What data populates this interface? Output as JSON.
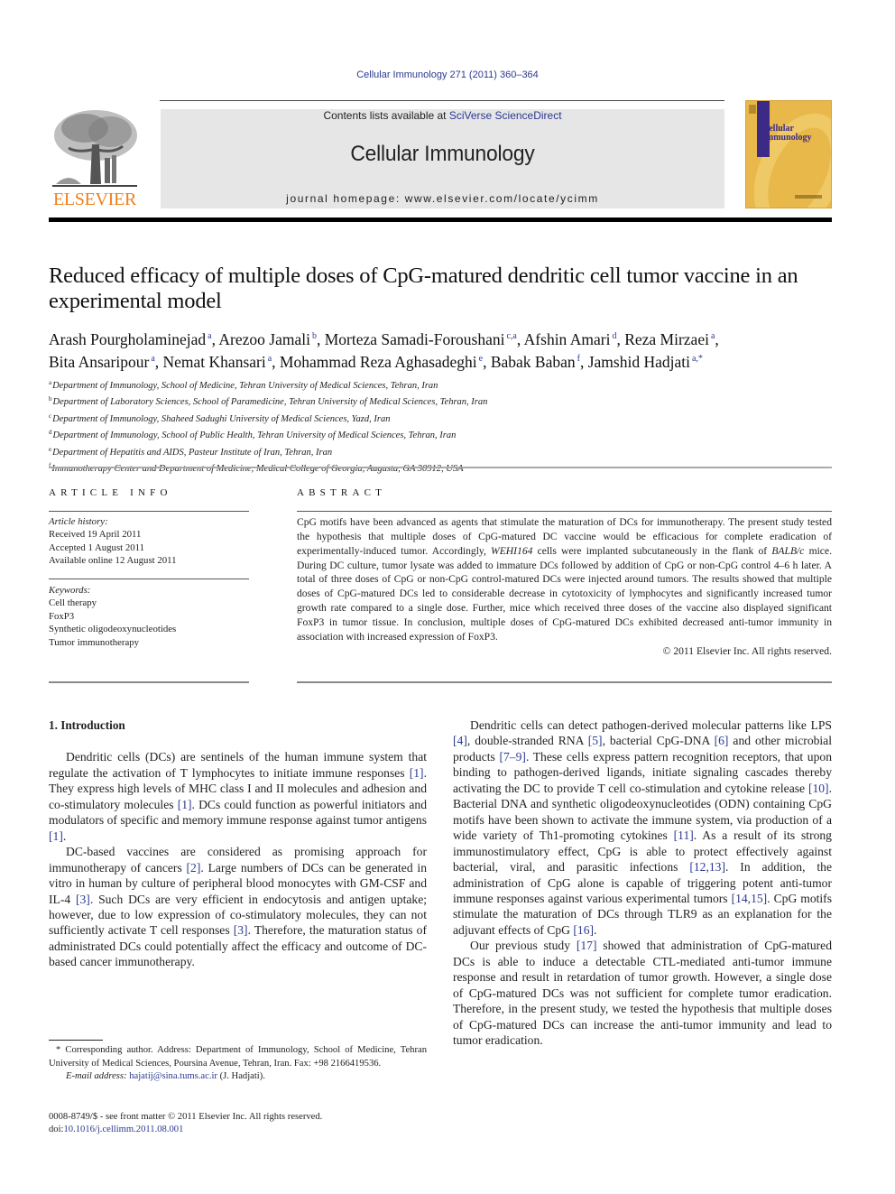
{
  "header": {
    "citation": "Cellular Immunology 271 (2011) 360–364",
    "contents_prefix": "Contents lists available at ",
    "contents_link": "SciVerse ScienceDirect",
    "journal_name": "Cellular Immunology",
    "homepage_prefix": "journal homepage: ",
    "homepage_url": "www.elsevier.com/locate/ycimm",
    "publisher_logo_text": "ELSEVIER",
    "cover_title_line1": "Cellular",
    "cover_title_line2": "Immunology"
  },
  "colors": {
    "link": "#2b3990",
    "elsevier_orange": "#f07f1b",
    "banner_grey": "#e6e6e6",
    "cover_gold": "#e8b84a",
    "cover_purple": "#3c2a87"
  },
  "article": {
    "title": "Reduced efficacy of multiple doses of CpG-matured dendritic cell tumor vaccine in an experimental model",
    "authors": [
      {
        "name": "Arash Pourgholaminejad",
        "aff": "a"
      },
      {
        "name": "Arezoo Jamali",
        "aff": "b"
      },
      {
        "name": "Morteza Samadi-Foroushani",
        "aff": "c,a"
      },
      {
        "name": "Afshin Amari",
        "aff": "d"
      },
      {
        "name": "Reza Mirzaei",
        "aff": "a"
      },
      {
        "name": "Bita Ansaripour",
        "aff": "a"
      },
      {
        "name": "Nemat Khansari",
        "aff": "a"
      },
      {
        "name": "Mohammad Reza Aghasadeghi",
        "aff": "e"
      },
      {
        "name": "Babak Baban",
        "aff": "f"
      },
      {
        "name": "Jamshid Hadjati",
        "aff": "a,*"
      }
    ],
    "affiliations": [
      {
        "key": "a",
        "text": "Department of Immunology, School of Medicine, Tehran University of Medical Sciences, Tehran, Iran"
      },
      {
        "key": "b",
        "text": "Department of Laboratory Sciences, School of Paramedicine, Tehran University of Medical Sciences, Tehran, Iran"
      },
      {
        "key": "c",
        "text": "Department of Immunology, Shaheed Sadughi University of Medical Sciences, Yazd, Iran"
      },
      {
        "key": "d",
        "text": "Department of Immunology, School of Public Health, Tehran University of Medical Sciences, Tehran, Iran"
      },
      {
        "key": "e",
        "text": "Department of Hepatitis and AIDS, Pasteur Institute of Iran, Tehran, Iran"
      },
      {
        "key": "f",
        "text": "Immunotherapy Center and Department of Medicine, Medical College of Georgia, Augusta, GA 30912, USA"
      }
    ]
  },
  "article_info": {
    "heading": "ARTICLE INFO",
    "history_label": "Article history:",
    "received": "Received 19 April 2011",
    "accepted": "Accepted 1 August 2011",
    "online": "Available online 12 August 2011",
    "keywords_label": "Keywords:",
    "keywords": [
      "Cell therapy",
      "FoxP3",
      "Synthetic oligodeoxynucleotides",
      "Tumor immunotherapy"
    ]
  },
  "abstract": {
    "heading": "ABSTRACT",
    "part1": "CpG motifs have been advanced as agents that stimulate the maturation of DCs for immunotherapy. The present study tested the hypothesis that multiple doses of CpG-matured DC vaccine would be efficacious for complete eradication of experimentally-induced tumor. Accordingly, ",
    "italic1": "WEHI164",
    "part2": " cells were implanted subcutaneously in the flank of ",
    "italic2": "BALB/c",
    "part3": " mice. During DC culture, tumor lysate was added to immature DCs followed by addition of CpG or non-CpG control 4–6 h later. A total of three doses of CpG or non-CpG control-matured DCs were injected around tumors. The results showed that multiple doses of CpG-matured DCs led to considerable decrease in cytotoxicity of lymphocytes and significantly increased tumor growth rate compared to a single dose. Further, mice which received three doses of the vaccine also displayed significant FoxP3 in tumor tissue. In conclusion, multiple doses of CpG-matured DCs exhibited decreased anti-tumor immunity in association with increased expression of FoxP3.",
    "copyright": "© 2011 Elsevier Inc. All rights reserved."
  },
  "body": {
    "section_title": "1. Introduction",
    "left_paragraphs": [
      [
        {
          "t": "Dendritic cells (DCs) are sentinels of the human immune system that regulate the activation of T lymphocytes to initiate immune responses "
        },
        {
          "c": "[1]"
        },
        {
          "t": ". They express high levels of MHC class I and II molecules and adhesion and co-stimulatory molecules "
        },
        {
          "c": "[1]"
        },
        {
          "t": ". DCs could function as powerful initiators and modulators of specific and memory immune response against tumor antigens "
        },
        {
          "c": "[1]"
        },
        {
          "t": "."
        }
      ],
      [
        {
          "t": "DC-based vaccines are considered as promising approach for immunotherapy of cancers "
        },
        {
          "c": "[2]"
        },
        {
          "t": ". Large numbers of DCs can be generated in vitro in human by culture of peripheral blood monocytes with GM-CSF and IL-4 "
        },
        {
          "c": "[3]"
        },
        {
          "t": ". Such DCs are very efficient in endocytosis and antigen uptake; however, due to low expression of co-stimulatory molecules, they can not sufficiently activate T cell responses "
        },
        {
          "c": "[3]"
        },
        {
          "t": ". Therefore, the maturation status of administrated DCs could potentially affect the efficacy and outcome of DC-based cancer immunotherapy."
        }
      ]
    ],
    "right_paragraphs": [
      [
        {
          "t": "Dendritic cells can detect pathogen-derived molecular patterns like LPS "
        },
        {
          "c": "[4]"
        },
        {
          "t": ", double-stranded RNA "
        },
        {
          "c": "[5]"
        },
        {
          "t": ", bacterial CpG-DNA "
        },
        {
          "c": "[6]"
        },
        {
          "t": " and other microbial products "
        },
        {
          "c": "[7–9]"
        },
        {
          "t": ". These cells express pattern recognition receptors, that upon binding to pathogen-derived ligands, initiate signaling cascades thereby activating the DC to provide T cell co-stimulation and cytokine release "
        },
        {
          "c": "[10]"
        },
        {
          "t": ". Bacterial DNA and synthetic oligodeoxynucleotides (ODN) containing CpG motifs have been shown to activate the immune system, via production of a wide variety of Th1-promoting cytokines "
        },
        {
          "c": "[11]"
        },
        {
          "t": ". As a result of its strong immunostimulatory effect, CpG is able to protect effectively against bacterial, viral, and parasitic infections "
        },
        {
          "c": "[12,13]"
        },
        {
          "t": ". In addition, the administration of CpG alone is capable of triggering potent anti-tumor immune responses against various experimental tumors "
        },
        {
          "c": "[14,15]"
        },
        {
          "t": ". CpG motifs stimulate the maturation of DCs through TLR9 as an explanation for the adjuvant effects of CpG "
        },
        {
          "c": "[16]"
        },
        {
          "t": "."
        }
      ],
      [
        {
          "t": "Our previous study "
        },
        {
          "c": "[17]"
        },
        {
          "t": " showed that administration of CpG-matured DCs is able to induce a detectable CTL-mediated anti-tumor immune response and result in retardation of tumor growth. However, a single dose of CpG-matured DCs was not sufficient for complete tumor eradication. Therefore, in the present study, we tested the hypothesis that multiple doses of CpG-matured DCs can increase the anti-tumor immunity and lead to tumor eradication."
        }
      ]
    ]
  },
  "footnote": {
    "corresponding": "* Corresponding author. Address: Department of Immunology, School of Medicine, Tehran University of Medical Sciences, Poursina Avenue, Tehran, Iran. Fax: +98 2166419536.",
    "email_label": "E-mail address:",
    "email": "hajatij@sina.tums.ac.ir",
    "email_suffix": " (J. Hadjati)."
  },
  "front_matter": {
    "issn_line": "0008-8749/$ - see front matter © 2011 Elsevier Inc. All rights reserved.",
    "doi_prefix": "doi:",
    "doi": "10.1016/j.cellimm.2011.08.001"
  }
}
